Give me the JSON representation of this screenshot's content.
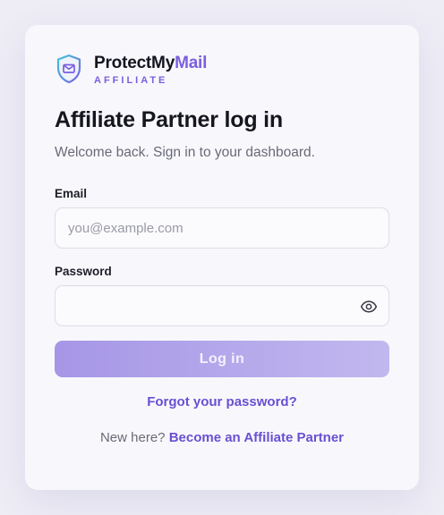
{
  "brand": {
    "name_main": "ProtectMy",
    "name_accent": "Mail",
    "subtitle": "AFFILIATE",
    "logo_icon": "shield-mail-icon"
  },
  "page": {
    "title": "Affiliate Partner log in",
    "subtitle": "Welcome back. Sign in to your dashboard."
  },
  "form": {
    "email_label": "Email",
    "email_placeholder": "you@example.com",
    "email_value": "",
    "password_label": "Password",
    "password_value": "",
    "password_toggle_icon": "eye-icon",
    "login_label": "Log in",
    "forgot_label": "Forgot your password?"
  },
  "footer": {
    "prompt": "New here?",
    "signup_label": "Become an Affiliate Partner"
  },
  "colors": {
    "accent": "#7b5ee0",
    "link": "#6a4fd3",
    "button_gradient_start": "#a696e6",
    "button_gradient_end": "#c2b8ef"
  }
}
